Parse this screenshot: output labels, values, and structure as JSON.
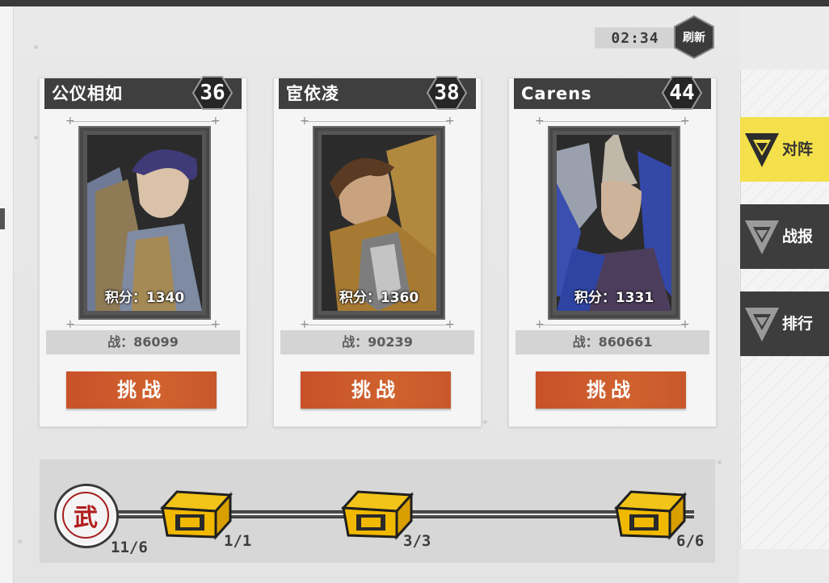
{
  "header": {
    "timer": "02:34",
    "refresh_label": "刷新"
  },
  "opponents": [
    {
      "name": "公仪相如",
      "level": "36",
      "score_label": "积分：1340",
      "power_label": "战：86099",
      "challenge_label": "挑战",
      "art": "purple-hair-warrior"
    },
    {
      "name": "宦依凌",
      "level": "38",
      "score_label": "积分：1360",
      "power_label": "战：90239",
      "challenge_label": "挑战",
      "art": "brown-coat-swordsman"
    },
    {
      "name": "Carens",
      "level": "44",
      "score_label": "积分：1331",
      "power_label": "战：860661",
      "challenge_label": "挑战",
      "art": "blue-fur-horned-helmet"
    }
  ],
  "tabs": [
    {
      "label": "对阵",
      "active": true,
      "icon": "triangle-emblem-icon"
    },
    {
      "label": "战报",
      "active": false,
      "icon": "triangle-emblem-icon"
    },
    {
      "label": "排行",
      "active": false,
      "icon": "triangle-emblem-icon"
    }
  ],
  "progress": {
    "medal_glyph": "武",
    "current_label": "11/6",
    "rewards": [
      {
        "label": "1/1",
        "icon": "treasure-chest-icon"
      },
      {
        "label": "3/3",
        "icon": "treasure-chest-icon"
      },
      {
        "label": "6/6",
        "icon": "treasure-chest-icon"
      }
    ]
  },
  "colors": {
    "accent_orange": "#c8512a",
    "active_tab_yellow": "#f3e04a",
    "header_dark": "#3f3f3f",
    "medal_red": "#b11d1d"
  }
}
